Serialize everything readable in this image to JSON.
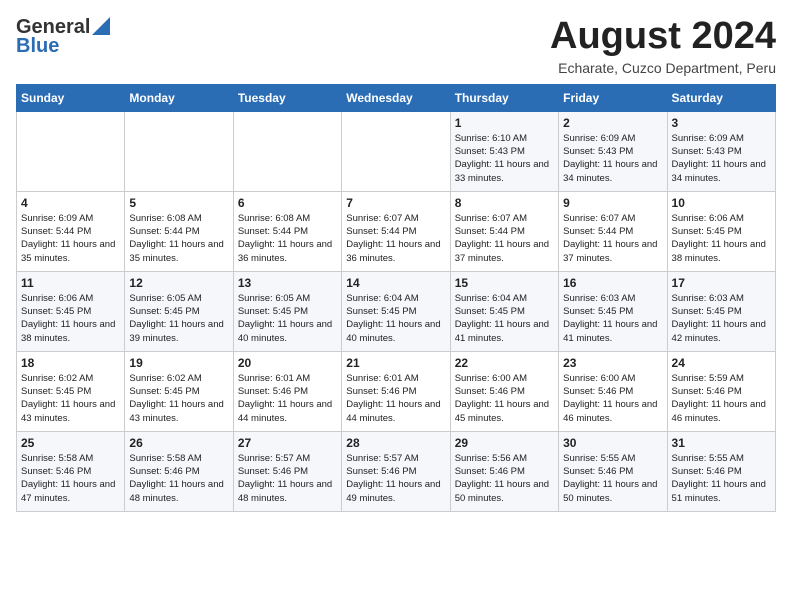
{
  "logo": {
    "general": "General",
    "blue": "Blue"
  },
  "title": {
    "month_year": "August 2024",
    "location": "Echarate, Cuzco Department, Peru"
  },
  "days_of_week": [
    "Sunday",
    "Monday",
    "Tuesday",
    "Wednesday",
    "Thursday",
    "Friday",
    "Saturday"
  ],
  "weeks": [
    [
      {
        "day": "",
        "sunrise": "",
        "sunset": "",
        "daylight": ""
      },
      {
        "day": "",
        "sunrise": "",
        "sunset": "",
        "daylight": ""
      },
      {
        "day": "",
        "sunrise": "",
        "sunset": "",
        "daylight": ""
      },
      {
        "day": "",
        "sunrise": "",
        "sunset": "",
        "daylight": ""
      },
      {
        "day": "1",
        "sunrise": "Sunrise: 6:10 AM",
        "sunset": "Sunset: 5:43 PM",
        "daylight": "Daylight: 11 hours and 33 minutes."
      },
      {
        "day": "2",
        "sunrise": "Sunrise: 6:09 AM",
        "sunset": "Sunset: 5:43 PM",
        "daylight": "Daylight: 11 hours and 34 minutes."
      },
      {
        "day": "3",
        "sunrise": "Sunrise: 6:09 AM",
        "sunset": "Sunset: 5:43 PM",
        "daylight": "Daylight: 11 hours and 34 minutes."
      }
    ],
    [
      {
        "day": "4",
        "sunrise": "Sunrise: 6:09 AM",
        "sunset": "Sunset: 5:44 PM",
        "daylight": "Daylight: 11 hours and 35 minutes."
      },
      {
        "day": "5",
        "sunrise": "Sunrise: 6:08 AM",
        "sunset": "Sunset: 5:44 PM",
        "daylight": "Daylight: 11 hours and 35 minutes."
      },
      {
        "day": "6",
        "sunrise": "Sunrise: 6:08 AM",
        "sunset": "Sunset: 5:44 PM",
        "daylight": "Daylight: 11 hours and 36 minutes."
      },
      {
        "day": "7",
        "sunrise": "Sunrise: 6:07 AM",
        "sunset": "Sunset: 5:44 PM",
        "daylight": "Daylight: 11 hours and 36 minutes."
      },
      {
        "day": "8",
        "sunrise": "Sunrise: 6:07 AM",
        "sunset": "Sunset: 5:44 PM",
        "daylight": "Daylight: 11 hours and 37 minutes."
      },
      {
        "day": "9",
        "sunrise": "Sunrise: 6:07 AM",
        "sunset": "Sunset: 5:44 PM",
        "daylight": "Daylight: 11 hours and 37 minutes."
      },
      {
        "day": "10",
        "sunrise": "Sunrise: 6:06 AM",
        "sunset": "Sunset: 5:45 PM",
        "daylight": "Daylight: 11 hours and 38 minutes."
      }
    ],
    [
      {
        "day": "11",
        "sunrise": "Sunrise: 6:06 AM",
        "sunset": "Sunset: 5:45 PM",
        "daylight": "Daylight: 11 hours and 38 minutes."
      },
      {
        "day": "12",
        "sunrise": "Sunrise: 6:05 AM",
        "sunset": "Sunset: 5:45 PM",
        "daylight": "Daylight: 11 hours and 39 minutes."
      },
      {
        "day": "13",
        "sunrise": "Sunrise: 6:05 AM",
        "sunset": "Sunset: 5:45 PM",
        "daylight": "Daylight: 11 hours and 40 minutes."
      },
      {
        "day": "14",
        "sunrise": "Sunrise: 6:04 AM",
        "sunset": "Sunset: 5:45 PM",
        "daylight": "Daylight: 11 hours and 40 minutes."
      },
      {
        "day": "15",
        "sunrise": "Sunrise: 6:04 AM",
        "sunset": "Sunset: 5:45 PM",
        "daylight": "Daylight: 11 hours and 41 minutes."
      },
      {
        "day": "16",
        "sunrise": "Sunrise: 6:03 AM",
        "sunset": "Sunset: 5:45 PM",
        "daylight": "Daylight: 11 hours and 41 minutes."
      },
      {
        "day": "17",
        "sunrise": "Sunrise: 6:03 AM",
        "sunset": "Sunset: 5:45 PM",
        "daylight": "Daylight: 11 hours and 42 minutes."
      }
    ],
    [
      {
        "day": "18",
        "sunrise": "Sunrise: 6:02 AM",
        "sunset": "Sunset: 5:45 PM",
        "daylight": "Daylight: 11 hours and 43 minutes."
      },
      {
        "day": "19",
        "sunrise": "Sunrise: 6:02 AM",
        "sunset": "Sunset: 5:45 PM",
        "daylight": "Daylight: 11 hours and 43 minutes."
      },
      {
        "day": "20",
        "sunrise": "Sunrise: 6:01 AM",
        "sunset": "Sunset: 5:46 PM",
        "daylight": "Daylight: 11 hours and 44 minutes."
      },
      {
        "day": "21",
        "sunrise": "Sunrise: 6:01 AM",
        "sunset": "Sunset: 5:46 PM",
        "daylight": "Daylight: 11 hours and 44 minutes."
      },
      {
        "day": "22",
        "sunrise": "Sunrise: 6:00 AM",
        "sunset": "Sunset: 5:46 PM",
        "daylight": "Daylight: 11 hours and 45 minutes."
      },
      {
        "day": "23",
        "sunrise": "Sunrise: 6:00 AM",
        "sunset": "Sunset: 5:46 PM",
        "daylight": "Daylight: 11 hours and 46 minutes."
      },
      {
        "day": "24",
        "sunrise": "Sunrise: 5:59 AM",
        "sunset": "Sunset: 5:46 PM",
        "daylight": "Daylight: 11 hours and 46 minutes."
      }
    ],
    [
      {
        "day": "25",
        "sunrise": "Sunrise: 5:58 AM",
        "sunset": "Sunset: 5:46 PM",
        "daylight": "Daylight: 11 hours and 47 minutes."
      },
      {
        "day": "26",
        "sunrise": "Sunrise: 5:58 AM",
        "sunset": "Sunset: 5:46 PM",
        "daylight": "Daylight: 11 hours and 48 minutes."
      },
      {
        "day": "27",
        "sunrise": "Sunrise: 5:57 AM",
        "sunset": "Sunset: 5:46 PM",
        "daylight": "Daylight: 11 hours and 48 minutes."
      },
      {
        "day": "28",
        "sunrise": "Sunrise: 5:57 AM",
        "sunset": "Sunset: 5:46 PM",
        "daylight": "Daylight: 11 hours and 49 minutes."
      },
      {
        "day": "29",
        "sunrise": "Sunrise: 5:56 AM",
        "sunset": "Sunset: 5:46 PM",
        "daylight": "Daylight: 11 hours and 50 minutes."
      },
      {
        "day": "30",
        "sunrise": "Sunrise: 5:55 AM",
        "sunset": "Sunset: 5:46 PM",
        "daylight": "Daylight: 11 hours and 50 minutes."
      },
      {
        "day": "31",
        "sunrise": "Sunrise: 5:55 AM",
        "sunset": "Sunset: 5:46 PM",
        "daylight": "Daylight: 11 hours and 51 minutes."
      }
    ]
  ]
}
